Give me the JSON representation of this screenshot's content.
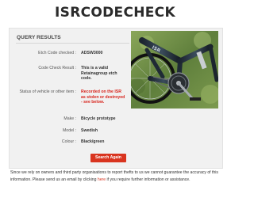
{
  "site": {
    "title": "ISRCODECHECK"
  },
  "results": {
    "heading": "QUERY RESULTS",
    "rows": [
      {
        "label": "Etch Code checked :",
        "value": "ADSW3000"
      },
      {
        "label": "Code Check Result :",
        "value": "This is a valid Retainagroup etch code."
      },
      {
        "label": "Status of vehicle or other item :",
        "value": "Recorded on the ISR as stolen or destroyed - see below."
      },
      {
        "label": "Make :",
        "value": "Bicycle prototype"
      },
      {
        "label": "Model :",
        "value": "Swedish"
      },
      {
        "label": "Colour :",
        "value": "Black/green"
      }
    ],
    "status_color": "#d8241c",
    "search_again_label": "Search Again"
  },
  "disclaimer": {
    "text_before": "Since we rely on owners and third party organisations to report thefts to us we cannot guarantee the accuracy of this information. Please send us an email by clicking ",
    "link_text": "here",
    "text_after": " if you require further information or assistance.",
    "link_color": "#d9341f"
  }
}
